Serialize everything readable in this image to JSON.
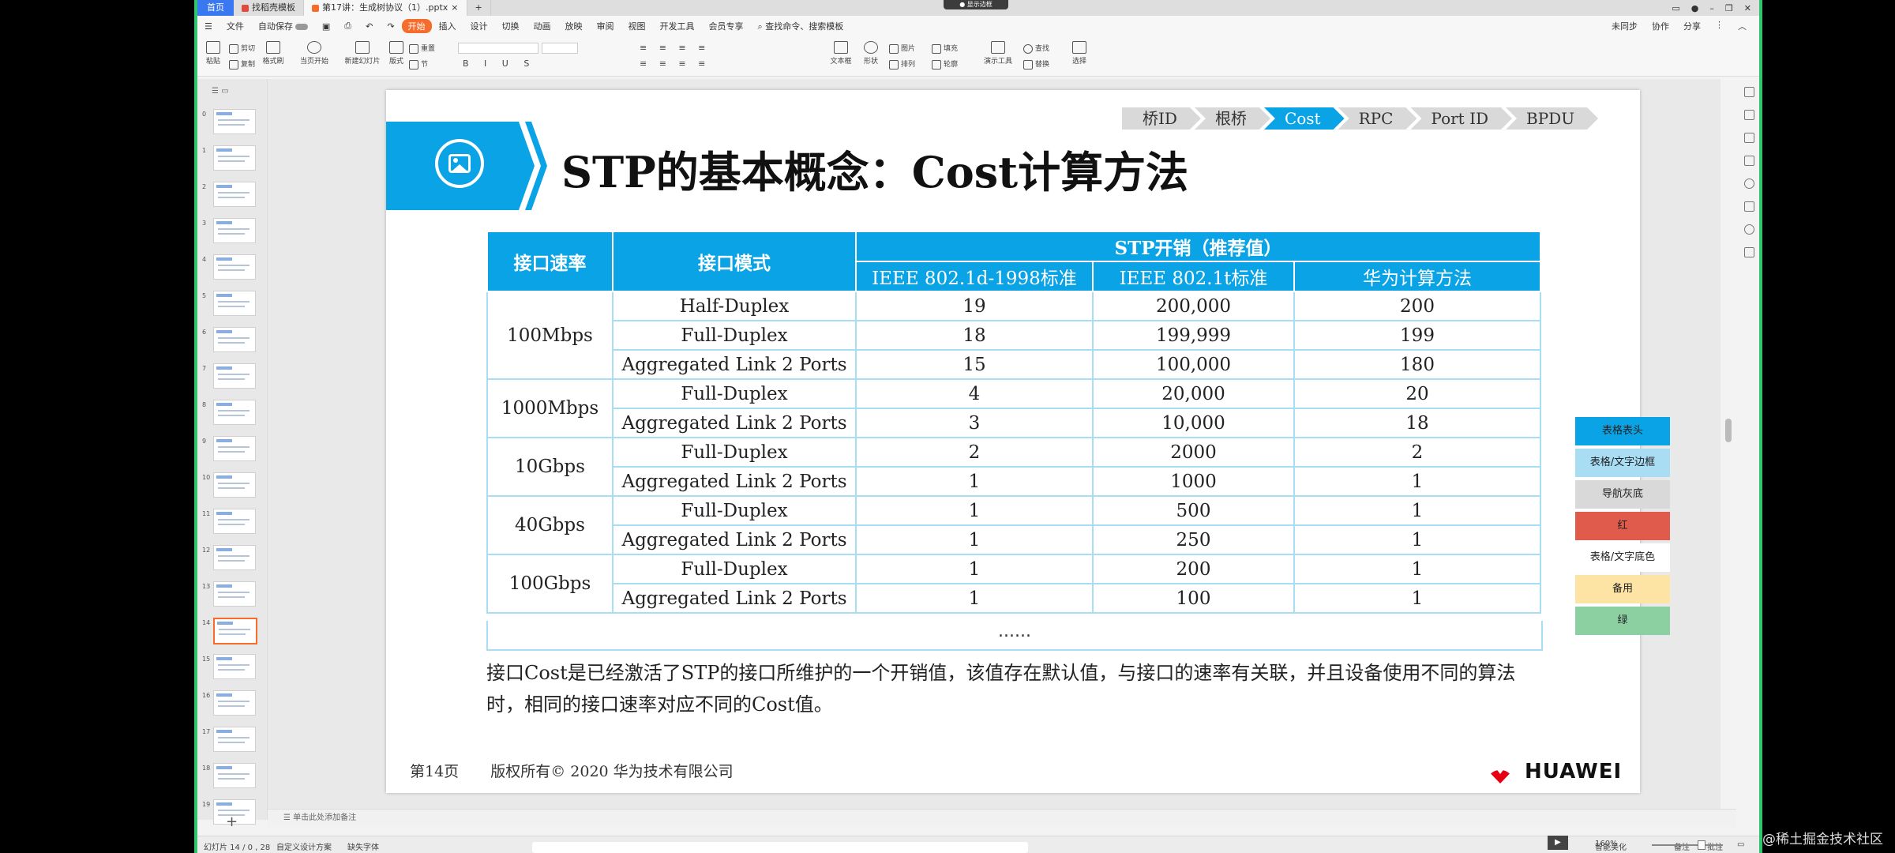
{
  "titlebar": {
    "home_tab": "首页",
    "template_tab": "找稻壳模板",
    "doc_tab": "第17讲：生成树协议（1）.pptx",
    "recording": "● 显示边框"
  },
  "menubar": {
    "items": [
      "文件",
      "自动保存",
      "开始",
      "插入",
      "设计",
      "切换",
      "动画",
      "放映",
      "审阅",
      "视图",
      "开发工具",
      "会员专享"
    ],
    "search_placeholder": "查找命令、搜索模板",
    "right": [
      "未同步",
      "协作",
      "分享"
    ]
  },
  "ribbon": {
    "paste": "粘贴",
    "cut": "剪切",
    "copy": "复制",
    "format_painter": "格式刷",
    "play_from_current": "当页开始",
    "new_slide": "新建幻灯片",
    "layout": "版式",
    "section": "节",
    "reset": "重置",
    "textbox": "文本框",
    "shape": "形状",
    "arrange": "排列",
    "picture": "图片",
    "fill": "填充",
    "outline": "轮廓",
    "present_tools": "演示工具",
    "find": "查找",
    "replace": "替换",
    "select": "选择"
  },
  "thumbnails": {
    "numbers": [
      "0",
      "1",
      "2",
      "3",
      "4",
      "5",
      "6",
      "7",
      "8",
      "9",
      "10",
      "11",
      "12",
      "13",
      "14",
      "15",
      "16",
      "17",
      "18",
      "19"
    ],
    "active_index": 14
  },
  "slide": {
    "nav_steps": [
      "桥ID",
      "根桥",
      "Cost",
      "RPC",
      "Port ID",
      "BPDU"
    ],
    "nav_active": "Cost",
    "title": "STP的基本概念：Cost计算方法",
    "table": {
      "header_rate": "接口速率",
      "header_mode": "接口模式",
      "header_cost": "STP开销（推荐值）",
      "sub_headers": [
        "IEEE 802.1d-1998标准",
        "IEEE 802.1t标准",
        "华为计算方法"
      ],
      "groups": [
        {
          "rate": "100Mbps",
          "rows": [
            {
              "mode": "Half-Duplex",
              "d": "19",
              "t": "200,000",
              "hw": "200"
            },
            {
              "mode": "Full-Duplex",
              "d": "18",
              "t": "199,999",
              "hw": "199"
            },
            {
              "mode": "Aggregated Link 2 Ports",
              "d": "15",
              "t": "100,000",
              "hw": "180"
            }
          ]
        },
        {
          "rate": "1000Mbps",
          "rows": [
            {
              "mode": "Full-Duplex",
              "d": "4",
              "t": "20,000",
              "hw": "20"
            },
            {
              "mode": "Aggregated Link 2 Ports",
              "d": "3",
              "t": "10,000",
              "hw": "18"
            }
          ]
        },
        {
          "rate": "10Gbps",
          "rows": [
            {
              "mode": "Full-Duplex",
              "d": "2",
              "t": "2000",
              "hw": "2"
            },
            {
              "mode": "Aggregated Link 2 Ports",
              "d": "1",
              "t": "1000",
              "hw": "1"
            }
          ]
        },
        {
          "rate": "40Gbps",
          "rows": [
            {
              "mode": "Full-Duplex",
              "d": "1",
              "t": "500",
              "hw": "1"
            },
            {
              "mode": "Aggregated Link 2 Ports",
              "d": "1",
              "t": "250",
              "hw": "1"
            }
          ]
        },
        {
          "rate": "100Gbps",
          "rows": [
            {
              "mode": "Full-Duplex",
              "d": "1",
              "t": "200",
              "hw": "1"
            },
            {
              "mode": "Aggregated Link 2 Ports",
              "d": "1",
              "t": "100",
              "hw": "1"
            }
          ]
        }
      ],
      "ellipsis": "......"
    },
    "description": "接口Cost是已经激活了STP的接口所维护的一个开销值，该值存在默认值，与接口的速率有关联，并且设备使用不同的算法时，相同的接口速率对应不同的Cost值。",
    "footer_page": "第14页",
    "footer_copyright": "版权所有© 2020 华为技术有限公司",
    "logo_text": "HUAWEI"
  },
  "palette": [
    {
      "label": "表格表头",
      "color": "#0aa3e6"
    },
    {
      "label": "表格/文字边框",
      "color": "#a8ddf3"
    },
    {
      "label": "导航灰底",
      "color": "#d9d9d9"
    },
    {
      "label": "红",
      "color": "#e15b4c"
    },
    {
      "label": "表格/文字底色",
      "color": "#ffffff"
    },
    {
      "label": "备用",
      "color": "#fde3a4"
    },
    {
      "label": "绿",
      "color": "#8ccfa0"
    }
  ],
  "notes_placeholder": "单击此处添加备注",
  "statusbar": {
    "slide_info": "幻灯片 14 / 0 , 28",
    "theme": "自定义设计方案",
    "font_missing": "缺失字体",
    "smart_beautify": "智能美化",
    "notes": "备注",
    "comments": "批注",
    "zoom": "160%"
  },
  "watermark": "@稀土掘金技术社区"
}
